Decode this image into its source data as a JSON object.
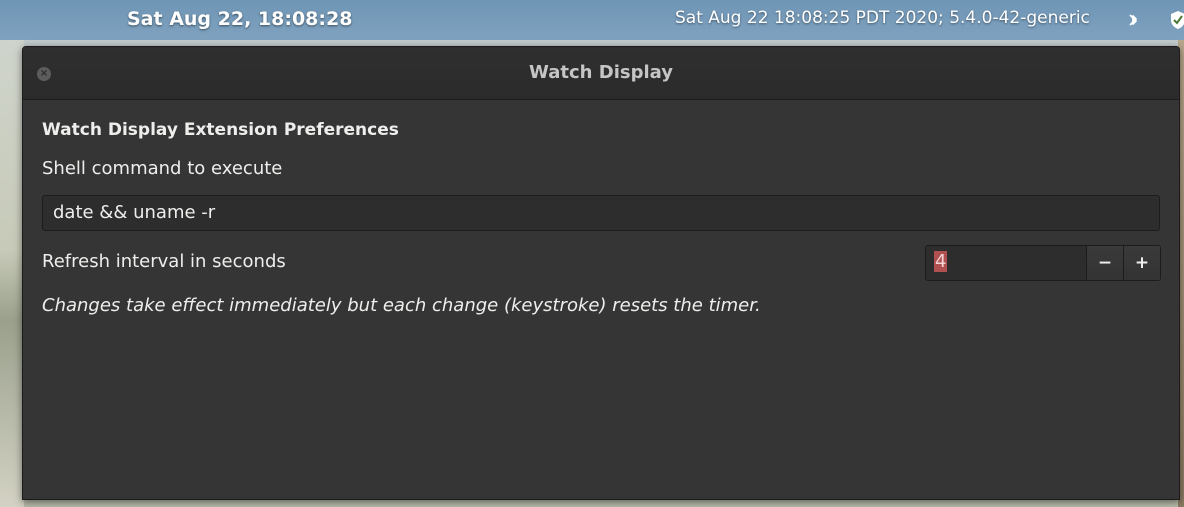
{
  "panel": {
    "clock": "Sat Aug 22, 18:08:28",
    "watch_output": "Sat Aug 22 18:08:25 PDT 2020; 5.4.0-42-generic",
    "tray_icons": [
      "bluetooth-icon",
      "shield-icon"
    ]
  },
  "window": {
    "title": "Watch Display",
    "close_glyph": "×",
    "heading": "Watch Display Extension Preferences",
    "command_label": "Shell command to execute",
    "command_value": "date && uname -r",
    "interval_label": "Refresh interval in seconds",
    "interval_value": "4",
    "decrement": "−",
    "increment": "+",
    "note": "Changes take effect immediately but each change (keystroke) resets the timer."
  },
  "colors": {
    "window_bg": "#353535",
    "titlebar_bg": "#2b2b2b",
    "text": "#eeeeec",
    "selection": "#b05050",
    "panel_bg": "#7fa2bf"
  }
}
